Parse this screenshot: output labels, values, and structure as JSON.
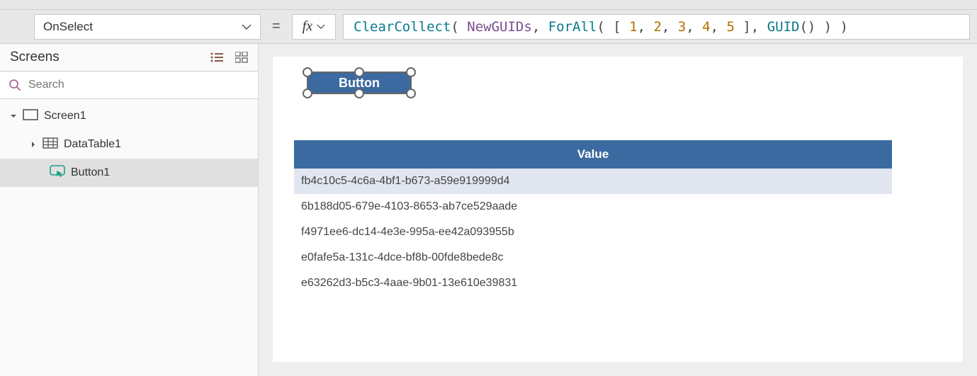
{
  "property_dropdown": {
    "selected": "OnSelect"
  },
  "fx_label": "fx",
  "formula": {
    "tokens": [
      {
        "t": "ClearCollect",
        "c": "tk-fn"
      },
      {
        "t": "( ",
        "c": "tk-op tk-sp"
      },
      {
        "t": "NewGUIDs",
        "c": "tk-id"
      },
      {
        "t": ", ",
        "c": "tk-op tk-sp"
      },
      {
        "t": "ForAll",
        "c": "tk-fn"
      },
      {
        "t": "( [ ",
        "c": "tk-op tk-sp"
      },
      {
        "t": "1",
        "c": "tk-num"
      },
      {
        "t": ", ",
        "c": "tk-op tk-sp"
      },
      {
        "t": "2",
        "c": "tk-num"
      },
      {
        "t": ", ",
        "c": "tk-op tk-sp"
      },
      {
        "t": "3",
        "c": "tk-num"
      },
      {
        "t": ", ",
        "c": "tk-op tk-sp"
      },
      {
        "t": "4",
        "c": "tk-num"
      },
      {
        "t": ", ",
        "c": "tk-op tk-sp"
      },
      {
        "t": "5",
        "c": "tk-num"
      },
      {
        "t": " ], ",
        "c": "tk-op tk-sp"
      },
      {
        "t": "GUID",
        "c": "tk-fn"
      },
      {
        "t": "() ) )",
        "c": "tk-op tk-sp"
      }
    ]
  },
  "side": {
    "title": "Screens",
    "search_placeholder": "Search",
    "tree": {
      "screen": "Screen1",
      "datatable": "DataTable1",
      "button": "Button1"
    }
  },
  "canvas": {
    "button_text": "Button",
    "table": {
      "header": "Value",
      "rows": [
        "fb4c10c5-4c6a-4bf1-b673-a59e919999d4",
        "6b188d05-679e-4103-8653-ab7ce529aade",
        "f4971ee6-dc14-4e3e-995a-ee42a093955b",
        "e0fafe5a-131c-4dce-bf8b-00fde8bede8c",
        "e63262d3-b5c3-4aae-9b01-13e610e39831"
      ]
    }
  }
}
